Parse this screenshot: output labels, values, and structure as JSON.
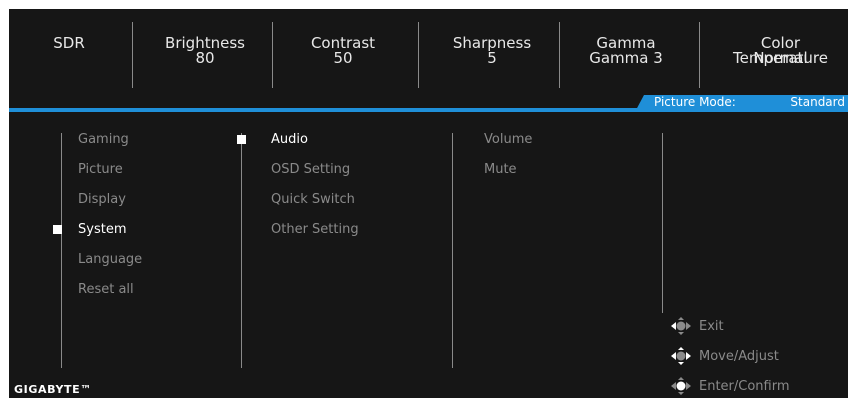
{
  "header": {
    "items": [
      {
        "title": "SDR",
        "value": ""
      },
      {
        "title": "Brightness",
        "value": "80"
      },
      {
        "title": "Contrast",
        "value": "50"
      },
      {
        "title": "Sharpness",
        "value": "5"
      },
      {
        "title": "Gamma",
        "value": "Gamma 3"
      },
      {
        "title": "Color Temperature",
        "value": "Normal"
      }
    ]
  },
  "picture_mode": {
    "label": "Picture Mode:",
    "value": "Standard"
  },
  "menu": {
    "main": [
      {
        "label": "Gaming",
        "selected": false
      },
      {
        "label": "Picture",
        "selected": false
      },
      {
        "label": "Display",
        "selected": false
      },
      {
        "label": "System",
        "selected": true
      },
      {
        "label": "Language",
        "selected": false
      },
      {
        "label": "Reset all",
        "selected": false
      }
    ],
    "sub": [
      {
        "label": "Audio",
        "selected": true
      },
      {
        "label": "OSD Setting",
        "selected": false
      },
      {
        "label": "Quick Switch",
        "selected": false
      },
      {
        "label": "Other Setting",
        "selected": false
      }
    ],
    "options": [
      {
        "label": "Volume"
      },
      {
        "label": "Mute"
      }
    ]
  },
  "hints": [
    {
      "icon": "joystick-left-icon",
      "label": "Exit"
    },
    {
      "icon": "joystick-all-directions-icon",
      "label": "Move/Adjust"
    },
    {
      "icon": "joystick-press-icon",
      "label": "Enter/Confirm"
    }
  ],
  "brand": {
    "logo": "GIGABYTE™"
  },
  "colors": {
    "background": "#161616",
    "accent": "#1f8fd8",
    "text_active": "#ffffff",
    "text_inactive": "#8a8a8a"
  }
}
